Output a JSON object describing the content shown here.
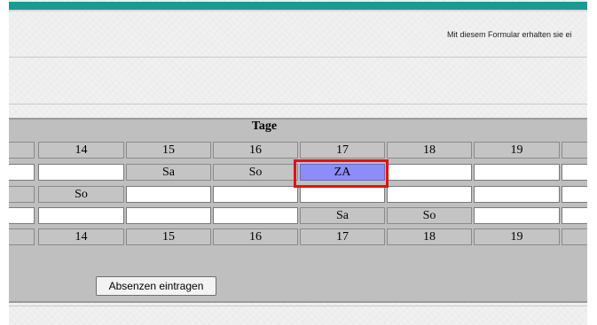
{
  "header": {
    "info_text": "Mit diesem Formular erhalten sie ei"
  },
  "calendar": {
    "title": "Tage",
    "days_top": [
      "14",
      "15",
      "16",
      "17",
      "18",
      "19"
    ],
    "row1": [
      "",
      "Sa",
      "So",
      "ZA",
      "",
      ""
    ],
    "row2": [
      "So",
      "",
      "",
      "",
      "",
      ""
    ],
    "row3": [
      "",
      "",
      "",
      "Sa",
      "So",
      ""
    ],
    "days_bottom": [
      "14",
      "15",
      "16",
      "17",
      "18",
      "19"
    ]
  },
  "actions": {
    "submit_label": "Absenzen eintragen"
  },
  "colors": {
    "topbar": "#1a9a92",
    "za_cell": "#8d8dfa",
    "highlight": "#e01313"
  }
}
